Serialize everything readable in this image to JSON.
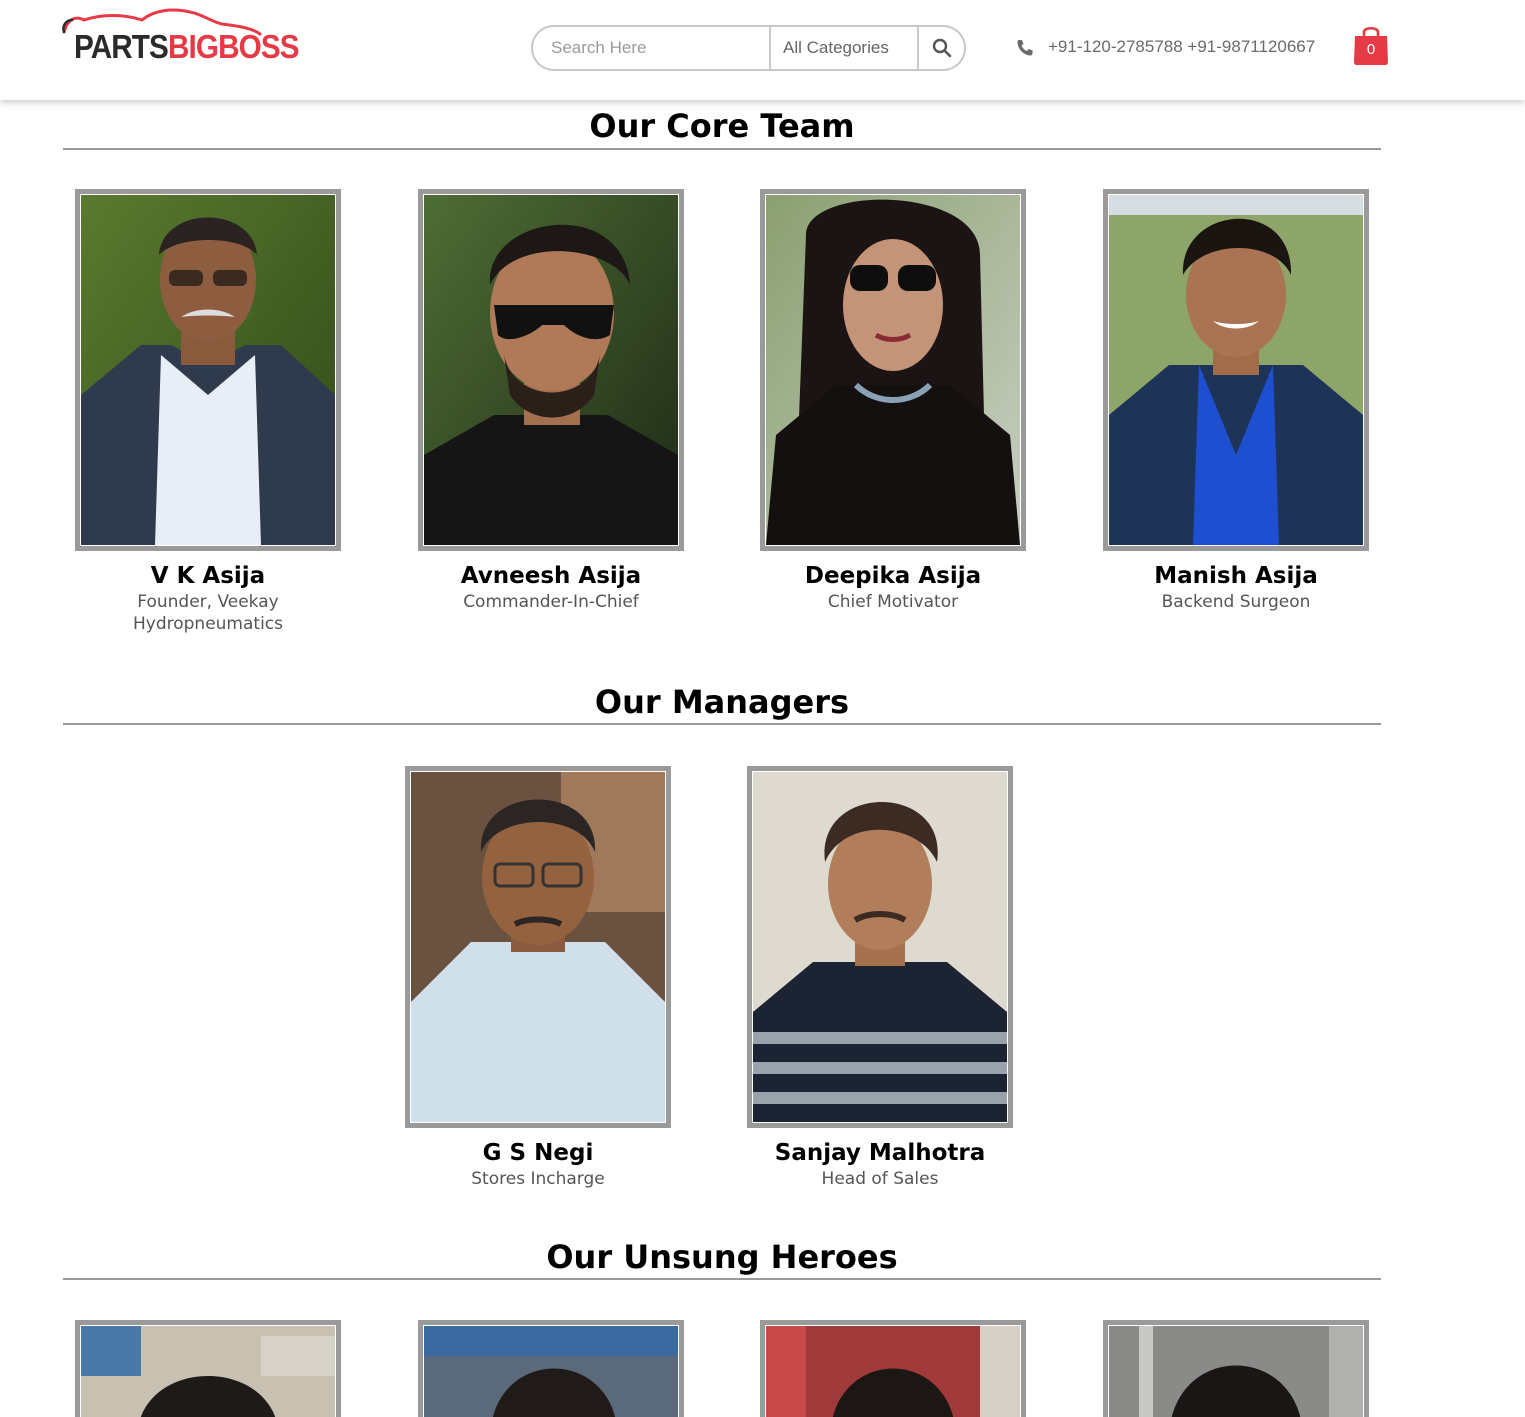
{
  "header": {
    "logo": {
      "text_parts": "PARTS",
      "text_brand": "BIGBOSS",
      "alt": "PartsBigBoss"
    },
    "search": {
      "placeholder": "Search Here",
      "category": "All Categories",
      "search_icon": "search-icon"
    },
    "contact": {
      "phone_icon": "phone-icon",
      "phones": "+91-120-2785788 +91-9871120667"
    },
    "cart": {
      "icon": "shopping-bag-icon",
      "count": "0"
    }
  },
  "colors": {
    "brand_red": "#e63a46",
    "border_gray": "#9a9a9a",
    "text_gray": "#555555"
  },
  "sections": {
    "core_team": {
      "title": "Our Core Team",
      "members": [
        {
          "name": "V K Asija",
          "role": "Founder, Veekay Hydropneumatics"
        },
        {
          "name": "Avneesh Asija",
          "role": "Commander-In-Chief"
        },
        {
          "name": "Deepika Asija",
          "role": "Chief Motivator"
        },
        {
          "name": "Manish Asija",
          "role": "Backend Surgeon"
        }
      ]
    },
    "managers": {
      "title": "Our Managers",
      "members": [
        {
          "name": "G S Negi",
          "role": "Stores Incharge"
        },
        {
          "name": "Sanjay Malhotra",
          "role": "Head of Sales"
        }
      ]
    },
    "heroes": {
      "title": "Our Unsung Heroes"
    }
  }
}
